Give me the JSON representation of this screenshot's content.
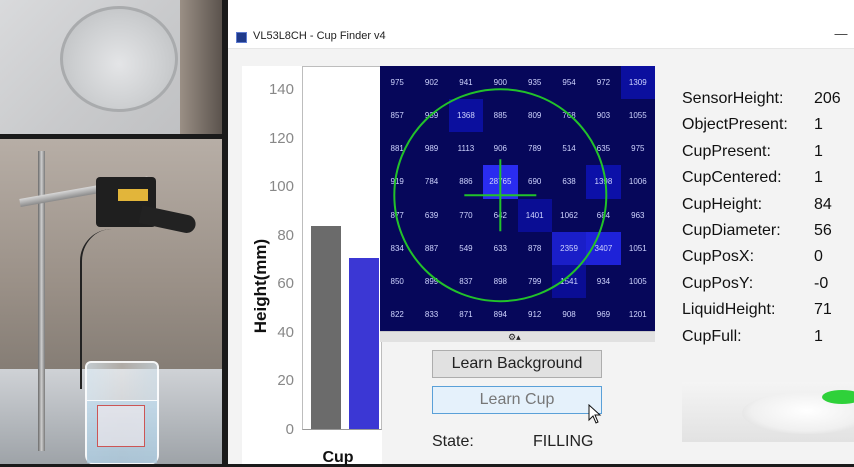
{
  "window": {
    "title": "VL53L8CH - Cup Finder v4",
    "minimize_glyph": "—"
  },
  "chart_data": {
    "type": "bar",
    "title": "",
    "categories": [
      "Cup"
    ],
    "series": [
      {
        "values": [
          84
        ],
        "color": "#6b6b6b"
      },
      {
        "values": [
          71
        ],
        "color": "#3b37d4"
      }
    ],
    "xlabel": "Cup",
    "ylabel": "Height(mm)",
    "ylim": [
      0,
      150
    ],
    "yticks": [
      "0",
      "20",
      "40",
      "60",
      "80",
      "100",
      "120",
      "140"
    ],
    "grid": false
  },
  "heatmap": {
    "values": [
      [
        "975",
        "902",
        "941",
        "900",
        "935",
        "954",
        "972",
        "1309"
      ],
      [
        "857",
        "939",
        "1368",
        "885",
        "809",
        "768",
        "903",
        "1055"
      ],
      [
        "881",
        "989",
        "1113",
        "906",
        "789",
        "514",
        "635",
        "975"
      ],
      [
        "919",
        "784",
        "886",
        "28765",
        "690",
        "638",
        "1398",
        "1006"
      ],
      [
        "877",
        "639",
        "770",
        "642",
        "1401",
        "1062",
        "684",
        "963"
      ],
      [
        "834",
        "887",
        "549",
        "633",
        "878",
        "2359",
        "3407",
        "1051"
      ],
      [
        "850",
        "899",
        "837",
        "898",
        "799",
        "1541",
        "934",
        "1005"
      ],
      [
        "822",
        "833",
        "871",
        "894",
        "912",
        "908",
        "969",
        "1201"
      ]
    ],
    "highlight_cells": [
      {
        "row": 0,
        "col": 7,
        "color": "#0b0f9e"
      },
      {
        "row": 1,
        "col": 2,
        "color": "#0b0f9e"
      },
      {
        "row": 3,
        "col": 3,
        "color": "#2a2cf0"
      },
      {
        "row": 3,
        "col": 6,
        "color": "#0c10a8"
      },
      {
        "row": 4,
        "col": 4,
        "color": "#0a0d94"
      },
      {
        "row": 5,
        "col": 5,
        "color": "#1a1ec8"
      },
      {
        "row": 5,
        "col": 6,
        "color": "#1e22d8"
      },
      {
        "row": 6,
        "col": 5,
        "color": "#0a0d94"
      }
    ],
    "overlay_color": "#22c22a",
    "toolbar_glyph": "⚙▴"
  },
  "buttons": {
    "learn_background": "Learn Background",
    "learn_cup": "Learn Cup"
  },
  "state": {
    "label": "State:",
    "value": "FILLING"
  },
  "readouts": [
    {
      "key": "SensorHeight:",
      "value": "206"
    },
    {
      "key": "ObjectPresent:",
      "value": "1"
    },
    {
      "key": "CupPresent:",
      "value": "1"
    },
    {
      "key": "CupCentered:",
      "value": "1"
    },
    {
      "key": "CupHeight:",
      "value": "84"
    },
    {
      "key": "CupDiameter:",
      "value": "56"
    },
    {
      "key": "CupPosX:",
      "value": "0"
    },
    {
      "key": "CupPosY:",
      "value": "-0"
    },
    {
      "key": "LiquidHeight:",
      "value": "71"
    },
    {
      "key": "CupFull:",
      "value": "1"
    }
  ]
}
